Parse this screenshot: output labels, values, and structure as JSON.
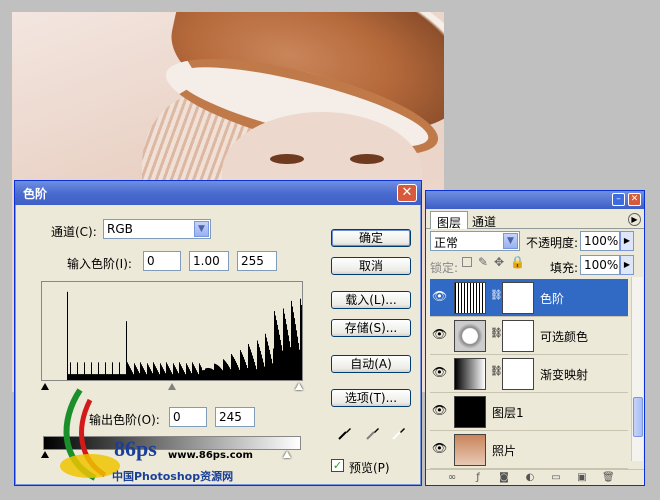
{
  "levels_dialog": {
    "title": "色阶",
    "close": "✕",
    "channel_label": "通道(C):",
    "channel_value": "RGB",
    "input_label": "输入色阶(I):",
    "input_black": "0",
    "input_gamma": "1.00",
    "input_white": "255",
    "output_label": "输出色阶(O):",
    "output_black": "0",
    "output_white": "245",
    "buttons": {
      "ok": "确定",
      "cancel": "取消",
      "load": "载入(L)...",
      "save": "存储(S)...",
      "auto": "自动(A)",
      "options": "选项(T)..."
    },
    "preview_label": "预览(P)",
    "preview_checked": true
  },
  "watermark": {
    "brand": "86ps",
    "url": "www.86ps.com",
    "site": "中国Photoshop资源网"
  },
  "layers_panel": {
    "tabs": [
      "图层",
      "通道"
    ],
    "blend_mode": "正常",
    "opacity_label": "不透明度:",
    "opacity_value": "100%",
    "lock_label": "锁定:",
    "fill_label": "填充:",
    "fill_value": "100%",
    "layers": [
      {
        "name": "色阶",
        "selected": true
      },
      {
        "name": "可选颜色",
        "selected": false
      },
      {
        "name": "渐变映射",
        "selected": false
      },
      {
        "name": "图层1",
        "selected": false
      },
      {
        "name": "照片",
        "selected": false
      }
    ]
  },
  "colors": {
    "titlebar": "#3d5ec6",
    "dialog_bg": "#ece9d8",
    "selection": "#316ac5",
    "photo_tint": "#c07a4a"
  }
}
